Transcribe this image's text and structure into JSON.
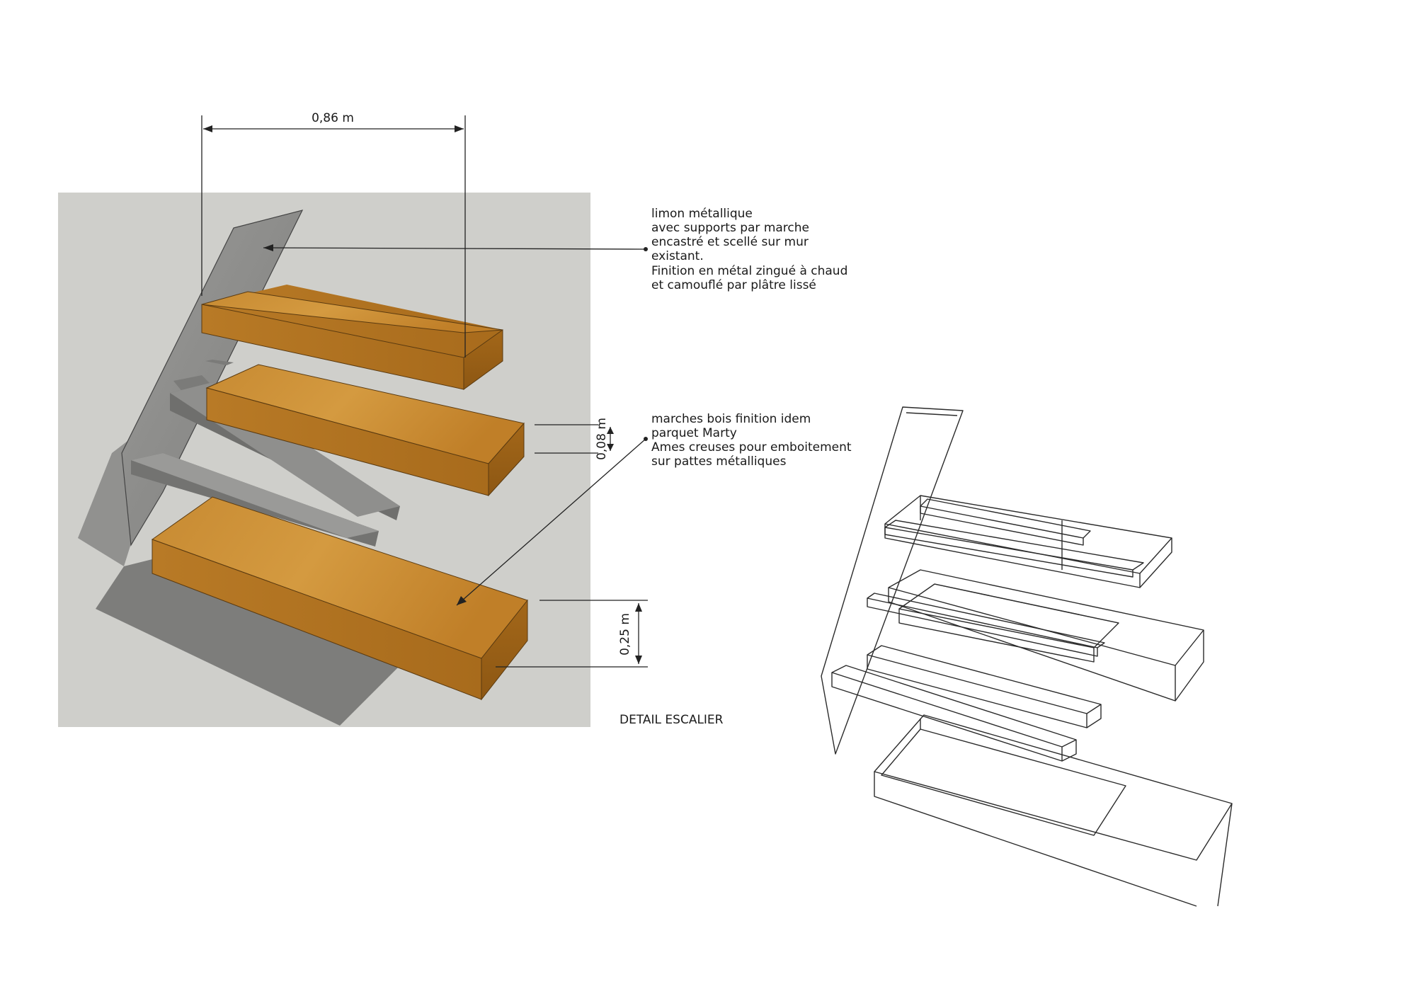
{
  "dimensions": {
    "width_label": "0,86 m",
    "riser_label": "0,08 m",
    "thickness_label": "0,25 m"
  },
  "notes": {
    "stringer": [
      "limon métallique",
      "avec supports par marche",
      "encastré et scellé sur mur",
      "existant.",
      "Finition en métal zingué à chaud",
      "et camouflé par plâtre lissé"
    ],
    "treads": [
      "marches bois finition idem",
      "parquet Marty",
      "Ames creuses pour emboitement",
      "sur pattes métalliques"
    ]
  },
  "caption": "DETAIL ESCALIER",
  "colors": {
    "background_panel": "#cfcfcb",
    "wood": "#c98a2e",
    "wood_dark": "#9c6418",
    "metal": "#8e8e8c",
    "shadow": "#7d7d7b"
  }
}
